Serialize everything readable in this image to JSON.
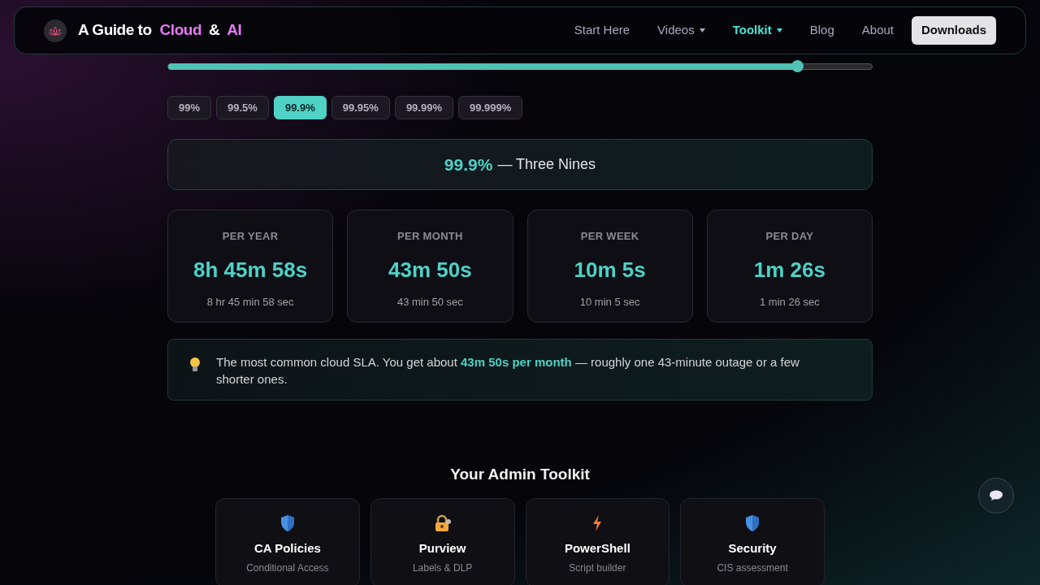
{
  "header": {
    "brand": {
      "prefix": "A Guide to",
      "highlight_1": "Cloud",
      "joiner": "&",
      "highlight_2": "AI"
    },
    "nav": [
      {
        "label": "Start Here",
        "dropdown": false,
        "selected": false
      },
      {
        "label": "Videos",
        "dropdown": true,
        "selected": false
      },
      {
        "label": "Toolkit",
        "dropdown": true,
        "selected": true
      },
      {
        "label": "Blog",
        "dropdown": false,
        "selected": false
      },
      {
        "label": "About",
        "dropdown": false,
        "selected": false
      }
    ],
    "cta": "Downloads"
  },
  "slider": {
    "level": 0.894
  },
  "presets": [
    {
      "label": "99%",
      "selected": false
    },
    {
      "label": "99.5%",
      "selected": false
    },
    {
      "label": "99.9%",
      "selected": true
    },
    {
      "label": "99.95%",
      "selected": false
    },
    {
      "label": "99.99%",
      "selected": false
    },
    {
      "label": "99.999%",
      "selected": false
    }
  ],
  "summary": {
    "value": "99.9%",
    "name": "— Three Nines"
  },
  "periods": [
    {
      "label": "PER YEAR",
      "value": "8h 45m 58s",
      "detail": "8 hr 45 min 58 sec"
    },
    {
      "label": "PER MONTH",
      "value": "43m 50s",
      "detail": "43 min 50 sec"
    },
    {
      "label": "PER WEEK",
      "value": "10m 5s",
      "detail": "10 min 5 sec"
    },
    {
      "label": "PER DAY",
      "value": "1m 26s",
      "detail": "1 min 26 sec"
    }
  ],
  "tip": "The most common cloud SLA. You get about **43m 50s per month** — roughly one 43-minute outage or a few shorter ones.",
  "toolkit": {
    "title": "Your Admin Toolkit",
    "cards": [
      {
        "kind": "shield",
        "title": "CA Policies",
        "subtitle": "Conditional Access"
      },
      {
        "kind": "lock",
        "title": "Purview",
        "subtitle": "Labels & DLP"
      },
      {
        "kind": "bolt",
        "title": "PowerShell",
        "subtitle": "Script builder"
      },
      {
        "kind": "shield",
        "title": "Security",
        "subtitle": "CIS assessment"
      }
    ]
  }
}
